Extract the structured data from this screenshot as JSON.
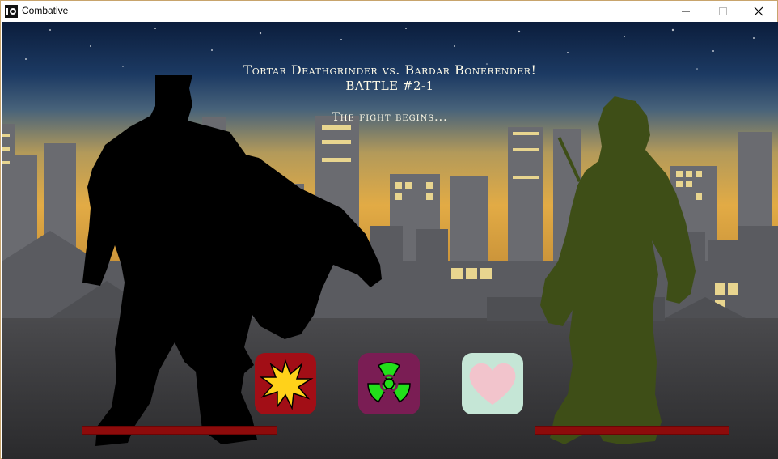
{
  "window": {
    "title": "Combative",
    "controls": [
      "minimize-icon",
      "maximize-icon",
      "close-icon"
    ]
  },
  "battle": {
    "matchup": "Tortar Deathgrinder vs. Bardar Bonerender!",
    "battle_number": "BATTLE #2-1",
    "narration": "The fight begins..."
  },
  "fighters": {
    "left": {
      "health_fraction": 1.0,
      "color": "#000000"
    },
    "right": {
      "health_fraction": 1.0,
      "color": "#3e4e17"
    }
  },
  "actions": [
    {
      "icon": "explosion-icon",
      "color": "#a20e16"
    },
    {
      "icon": "radiation-icon",
      "color": "#7a1d54"
    },
    {
      "icon": "heart-icon",
      "color": "#c5e6d6"
    }
  ],
  "colors": {
    "health_bar": "#8d0b0b",
    "text": "#fffbe8"
  }
}
